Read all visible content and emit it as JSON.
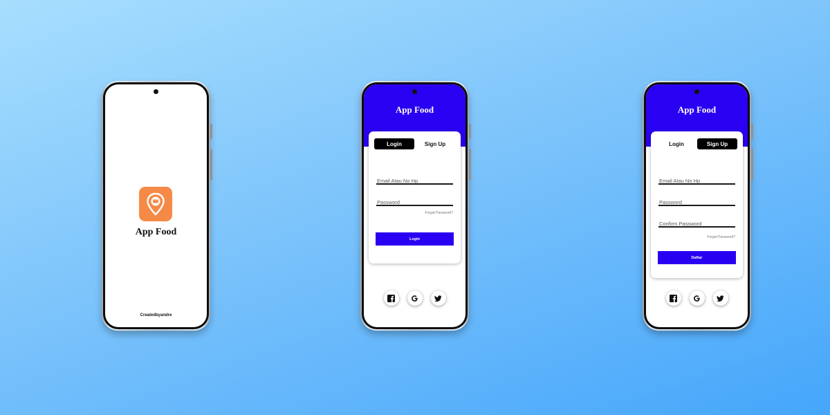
{
  "splash": {
    "app_title": "App Food",
    "credit": "Createdbyandre"
  },
  "login": {
    "header_title": "App Food",
    "tabs": [
      {
        "label": "Login",
        "active": true
      },
      {
        "label": "Sign Up",
        "active": false
      }
    ],
    "email_placeholder": "Email Atau No Hp",
    "password_placeholder": "Password",
    "forget_link": "Forget Password?",
    "submit_label": "Login"
  },
  "signup": {
    "header_title": "App Food",
    "tabs": [
      {
        "label": "Login",
        "active": false
      },
      {
        "label": "Sign Up",
        "active": true
      }
    ],
    "email_placeholder": "Email Atau No Hp",
    "password_placeholder": "Password",
    "confirm_placeholder": "Confirm Password",
    "forget_link": "Forget Password?",
    "submit_label": "Daftar"
  },
  "social_icons": [
    "facebook-icon",
    "google-icon",
    "twitter-icon"
  ],
  "colors": {
    "accent": "#2a00f2",
    "app_icon_bg": "#f58a47",
    "background_top": "#a7defe",
    "background_bottom": "#45a6fb"
  }
}
